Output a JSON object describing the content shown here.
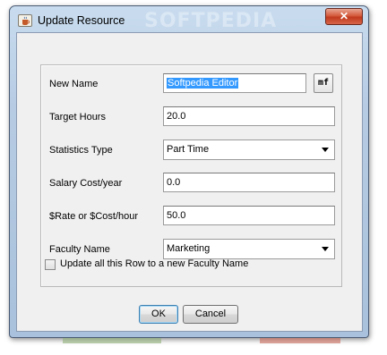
{
  "window": {
    "title": "Update Resource",
    "watermark": "SOFTPEDIA",
    "close_label": "✕"
  },
  "form": {
    "new_name_label": "New Name",
    "new_name_value": "Softpedia Editor",
    "mf_button_label": "mf",
    "target_hours_label": "Target Hours",
    "target_hours_value": "20.0",
    "statistics_type_label": "Statistics Type",
    "statistics_type_value": "Part Time",
    "salary_label": "Salary Cost/year",
    "salary_value": "0.0",
    "rate_label": "$Rate or $Cost/hour",
    "rate_value": "50.0",
    "faculty_name_label": "Faculty Name",
    "faculty_name_value": "Marketing",
    "update_row_label": "Update all this Row to a new Faculty Name",
    "update_row_checked": false
  },
  "buttons": {
    "ok_label": "OK",
    "cancel_label": "Cancel"
  },
  "icons": {
    "app": "coffee-cup-icon",
    "close": "close-icon",
    "dropdown": "chevron-down-icon"
  },
  "colors": {
    "selection": "#3399ff",
    "close_button": "#c03a1e",
    "titlebar": "#b7cce3"
  }
}
